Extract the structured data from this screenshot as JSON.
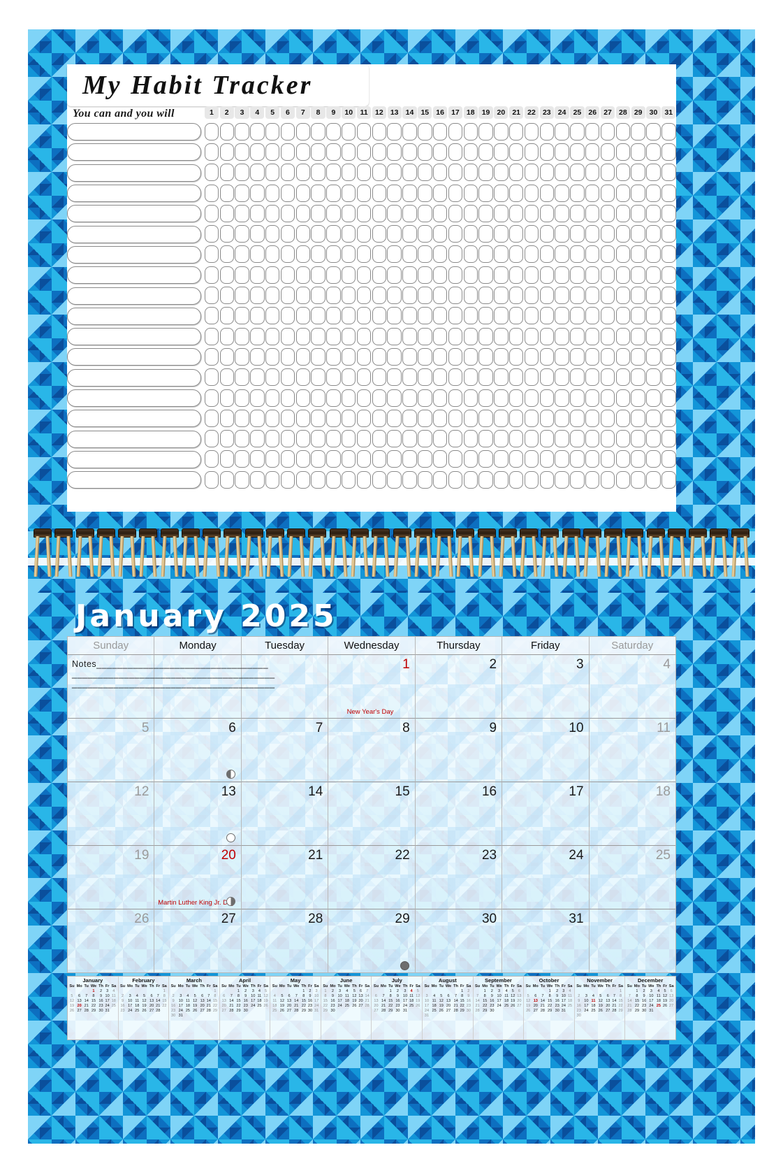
{
  "tracker": {
    "title": "My Habit Tracker",
    "motto": "You can and you will",
    "day_numbers": [
      1,
      2,
      3,
      4,
      5,
      6,
      7,
      8,
      9,
      10,
      11,
      12,
      13,
      14,
      15,
      16,
      17,
      18,
      19,
      20,
      21,
      22,
      23,
      24,
      25,
      26,
      27,
      28,
      29,
      30,
      31
    ],
    "row_count": 18,
    "habit_labels": [
      "",
      "",
      "",
      "",
      "",
      "",
      "",
      "",
      "",
      "",
      "",
      "",
      "",
      "",
      "",
      "",
      "",
      ""
    ]
  },
  "calendar": {
    "month_title": "January 2025",
    "weekdays": [
      "Sunday",
      "Monday",
      "Tuesday",
      "Wednesday",
      "Thursday",
      "Friday",
      "Saturday"
    ],
    "notes_label": "Notes",
    "notes_lines": [
      "Notes_________________________________",
      "_______________________________________",
      "_______________________________________"
    ],
    "weeks": [
      [
        {
          "num": "",
          "type": "notes"
        },
        {
          "num": "",
          "type": "notes"
        },
        {
          "num": "",
          "type": "notes"
        },
        {
          "num": "1",
          "type": "holiday",
          "holiday": "New Year's Day"
        },
        {
          "num": "2",
          "type": "weekday"
        },
        {
          "num": "3",
          "type": "weekday"
        },
        {
          "num": "4",
          "type": "weekend"
        }
      ],
      [
        {
          "num": "5",
          "type": "weekend"
        },
        {
          "num": "6",
          "type": "weekday",
          "moon": "last"
        },
        {
          "num": "7",
          "type": "weekday"
        },
        {
          "num": "8",
          "type": "weekday"
        },
        {
          "num": "9",
          "type": "weekday"
        },
        {
          "num": "10",
          "type": "weekday"
        },
        {
          "num": "11",
          "type": "weekend"
        }
      ],
      [
        {
          "num": "12",
          "type": "weekend"
        },
        {
          "num": "13",
          "type": "weekday",
          "moon": "full"
        },
        {
          "num": "14",
          "type": "weekday"
        },
        {
          "num": "15",
          "type": "weekday"
        },
        {
          "num": "16",
          "type": "weekday"
        },
        {
          "num": "17",
          "type": "weekday"
        },
        {
          "num": "18",
          "type": "weekend"
        }
      ],
      [
        {
          "num": "19",
          "type": "weekend"
        },
        {
          "num": "20",
          "type": "holiday",
          "holiday": "Martin Luther King Jr. Day",
          "moon": "first"
        },
        {
          "num": "21",
          "type": "weekday"
        },
        {
          "num": "22",
          "type": "weekday"
        },
        {
          "num": "23",
          "type": "weekday"
        },
        {
          "num": "24",
          "type": "weekday"
        },
        {
          "num": "25",
          "type": "weekend"
        }
      ],
      [
        {
          "num": "26",
          "type": "weekend"
        },
        {
          "num": "27",
          "type": "weekday"
        },
        {
          "num": "28",
          "type": "weekday"
        },
        {
          "num": "29",
          "type": "weekday",
          "moon": "new"
        },
        {
          "num": "30",
          "type": "weekday"
        },
        {
          "num": "31",
          "type": "weekday"
        },
        {
          "num": "",
          "type": "empty"
        }
      ]
    ]
  },
  "year_strip": {
    "dow_headers": [
      "Su",
      "Mo",
      "Tu",
      "We",
      "Th",
      "Fr",
      "Sa"
    ],
    "months": [
      {
        "name": "January",
        "start": 3,
        "days": 31,
        "holidays": [
          1,
          20
        ]
      },
      {
        "name": "February",
        "start": 6,
        "days": 28,
        "holidays": []
      },
      {
        "name": "March",
        "start": 6,
        "days": 31,
        "holidays": []
      },
      {
        "name": "April",
        "start": 2,
        "days": 30,
        "holidays": []
      },
      {
        "name": "May",
        "start": 4,
        "days": 31,
        "holidays": []
      },
      {
        "name": "June",
        "start": 0,
        "days": 30,
        "holidays": []
      },
      {
        "name": "July",
        "start": 2,
        "days": 31,
        "holidays": [
          4
        ]
      },
      {
        "name": "August",
        "start": 5,
        "days": 31,
        "holidays": []
      },
      {
        "name": "September",
        "start": 1,
        "days": 30,
        "holidays": []
      },
      {
        "name": "October",
        "start": 3,
        "days": 31,
        "holidays": [
          13
        ]
      },
      {
        "name": "November",
        "start": 6,
        "days": 30,
        "holidays": [
          11
        ]
      },
      {
        "name": "December",
        "start": 1,
        "days": 31,
        "holidays": [
          25
        ]
      }
    ]
  },
  "colors": {
    "pattern_dark": "#0a4f9c",
    "pattern_mid": "#1295d8",
    "pattern_light": "#7fd4f7",
    "pattern_accent": "#29b6e8",
    "holiday_red": "#c00000",
    "weekend_gray": "#9b9b9b"
  }
}
